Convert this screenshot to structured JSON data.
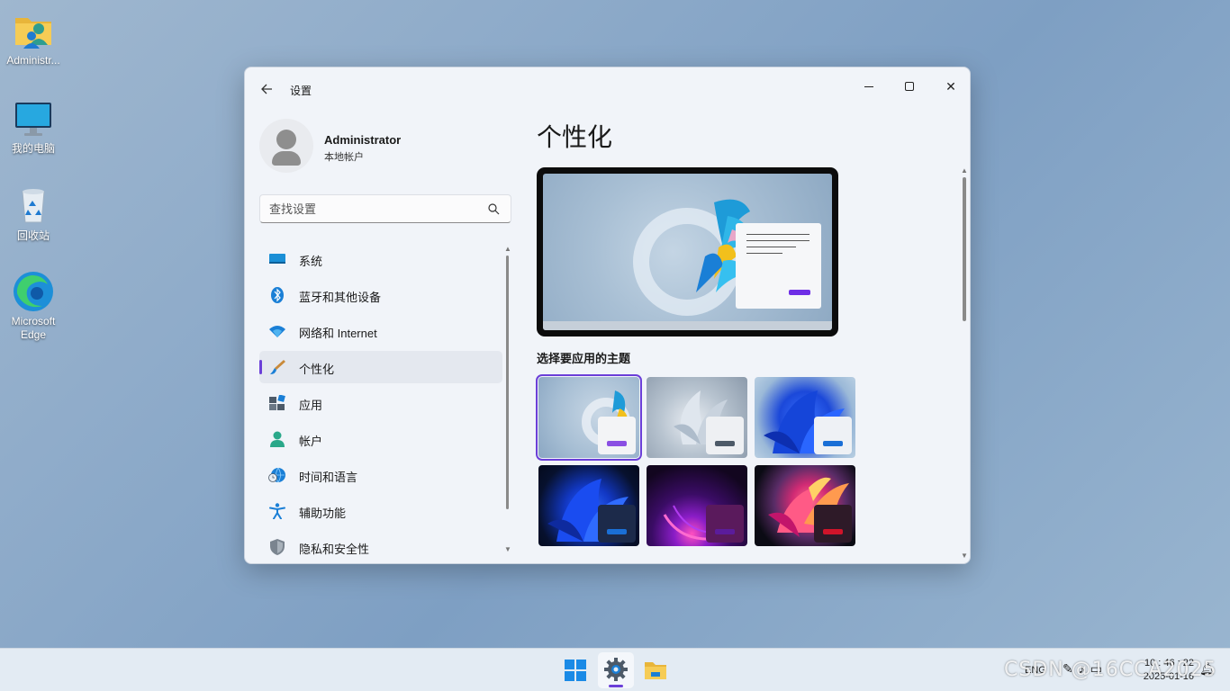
{
  "desktop": {
    "icons": [
      {
        "label": "Administr...",
        "icon": "user-folder-icon"
      },
      {
        "label": "我的电脑",
        "icon": "computer-icon"
      },
      {
        "label": "回收站",
        "icon": "recycle-bin-icon"
      },
      {
        "label": "Microsoft Edge",
        "icon": "edge-icon"
      }
    ]
  },
  "window": {
    "title": "设置",
    "back_icon": "back-arrow-icon",
    "controls": {
      "minimize": "minimize-icon",
      "maximize": "maximize-icon",
      "close": "✕"
    }
  },
  "profile": {
    "name": "Administrator",
    "account_type": "本地帐户"
  },
  "search": {
    "placeholder": "查找设置"
  },
  "sidebar": {
    "items": [
      {
        "label": "系统",
        "icon": "system-display-icon",
        "active": false
      },
      {
        "label": "蓝牙和其他设备",
        "icon": "bluetooth-icon",
        "active": false
      },
      {
        "label": "网络和 Internet",
        "icon": "wifi-icon",
        "active": false
      },
      {
        "label": "个性化",
        "icon": "paintbrush-icon",
        "active": true
      },
      {
        "label": "应用",
        "icon": "apps-icon",
        "active": false
      },
      {
        "label": "帐户",
        "icon": "account-icon",
        "active": false
      },
      {
        "label": "时间和语言",
        "icon": "globe-clock-icon",
        "active": false
      },
      {
        "label": "辅助功能",
        "icon": "accessibility-icon",
        "active": false
      },
      {
        "label": "隐私和安全性",
        "icon": "shield-icon",
        "active": false
      }
    ]
  },
  "main": {
    "title": "个性化",
    "themes_heading": "选择要应用的主题",
    "themes": [
      {
        "name": "glow-light",
        "accent": "#8a4fe3",
        "card": "#f3f4f6",
        "selected": true
      },
      {
        "name": "bloom-gray",
        "accent": "#4d5a68",
        "card": "#eef0f3",
        "selected": false
      },
      {
        "name": "bloom-blue-light",
        "accent": "#1a6fd6",
        "card": "#eef1f5",
        "selected": false
      },
      {
        "name": "bloom-blue-dark",
        "accent": "#1a6fd6",
        "card": "#1c2a4a",
        "selected": false
      },
      {
        "name": "glow-purple",
        "accent": "#5b1c9b",
        "card": "#5a1a5c",
        "selected": false
      },
      {
        "name": "flow-red",
        "accent": "#d0142a",
        "card": "#2e1a28",
        "selected": false
      }
    ]
  },
  "taskbar": {
    "apps": [
      {
        "name": "start",
        "icon": "windows-start-icon",
        "active": false
      },
      {
        "name": "settings",
        "icon": "gear-icon",
        "active": true
      },
      {
        "name": "file-explorer",
        "icon": "folder-icon",
        "active": false
      }
    ],
    "language": "ENG",
    "time": "10 : 46 : 22",
    "date": "2025-01-16"
  },
  "watermark": "CSDN @16CCA2025",
  "colors": {
    "accent": "#6b3fd8",
    "window_bg": "#f1f4f9",
    "taskbar_bg": "#e3ebf3"
  }
}
